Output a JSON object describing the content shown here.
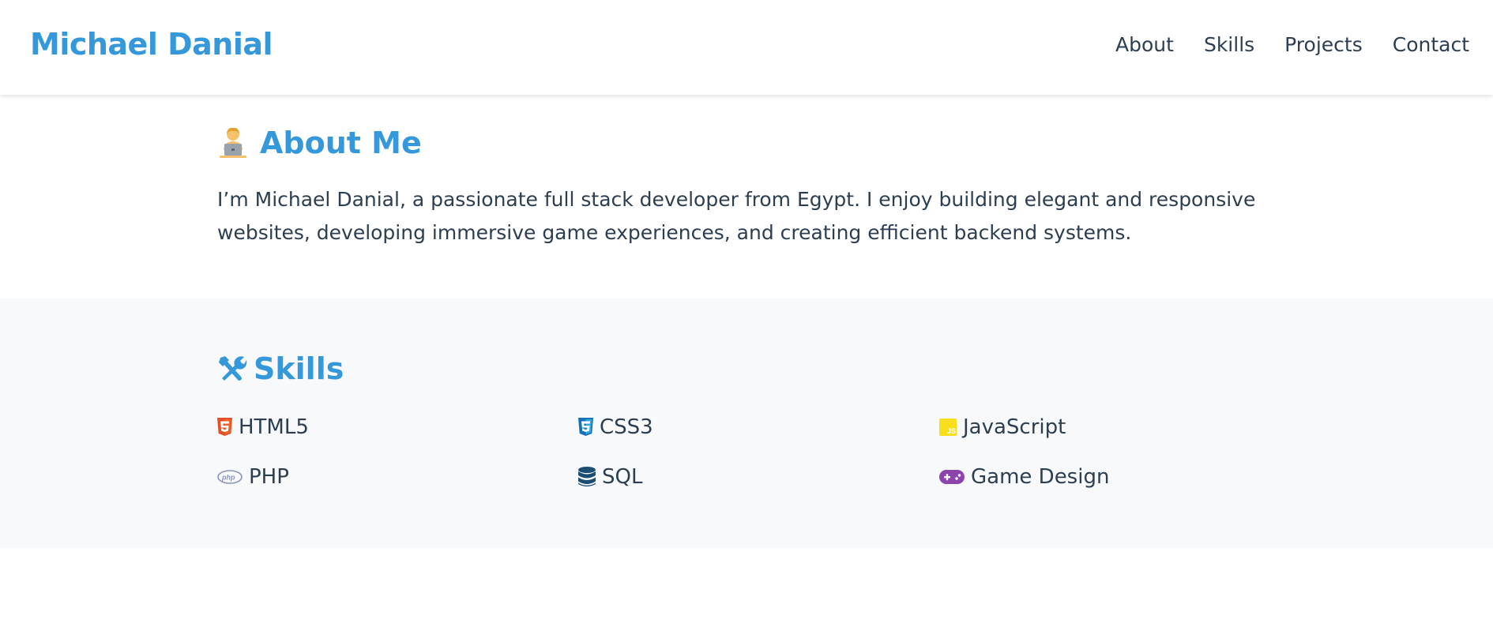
{
  "header": {
    "brand": "Michael Danial",
    "nav": [
      "About",
      "Skills",
      "Projects",
      "Contact"
    ]
  },
  "about": {
    "icon": "technologist-icon",
    "title": "About Me",
    "text": "I’m Michael Danial, a passionate full stack developer from Egypt. I enjoy building elegant and responsive websites, developing immersive game experiences, and creating efficient backend systems."
  },
  "skills": {
    "icon": "tools-icon",
    "title": "Skills",
    "items": [
      {
        "label": "HTML5",
        "icon": "html5-icon",
        "color": "#e34f26"
      },
      {
        "label": "CSS3",
        "icon": "css3-icon",
        "color": "#1572b6"
      },
      {
        "label": "JavaScript",
        "icon": "javascript-icon",
        "color": "#f7df1e"
      },
      {
        "label": "PHP",
        "icon": "php-icon",
        "color": "#8892bf"
      },
      {
        "label": "SQL",
        "icon": "database-icon",
        "color": "#1b4f72"
      },
      {
        "label": "Game Design",
        "icon": "gamepad-icon",
        "color": "#8e44ad"
      }
    ]
  },
  "colors": {
    "accent": "#3498db",
    "text": "#2c3e50",
    "skills_bg": "#f8f9fa"
  }
}
